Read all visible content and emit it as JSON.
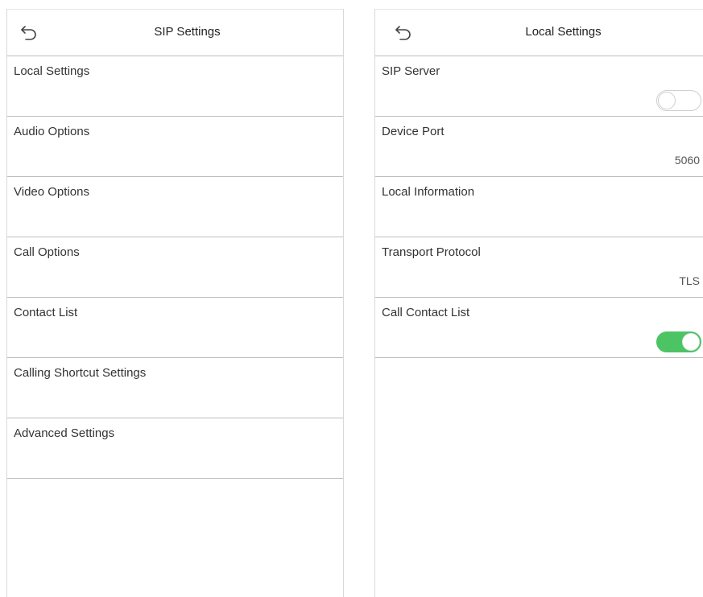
{
  "left": {
    "title": "SIP Settings",
    "back_icon": "back-arrow-icon",
    "items": [
      {
        "label": "Local Settings"
      },
      {
        "label": "Audio Options"
      },
      {
        "label": "Video Options"
      },
      {
        "label": "Call Options"
      },
      {
        "label": "Contact List"
      },
      {
        "label": "Calling Shortcut Settings"
      },
      {
        "label": "Advanced Settings"
      }
    ]
  },
  "right": {
    "title": "Local Settings",
    "back_icon": "back-arrow-icon",
    "items": [
      {
        "label": "SIP Server",
        "toggle": "off"
      },
      {
        "label": "Device Port",
        "value": "5060"
      },
      {
        "label": "Local Information"
      },
      {
        "label": "Transport Protocol",
        "value": "TLS"
      },
      {
        "label": "Call Contact List",
        "toggle": "on"
      }
    ]
  },
  "colors": {
    "toggle_on": "#4cc463",
    "divider": "#bdbdbd"
  }
}
